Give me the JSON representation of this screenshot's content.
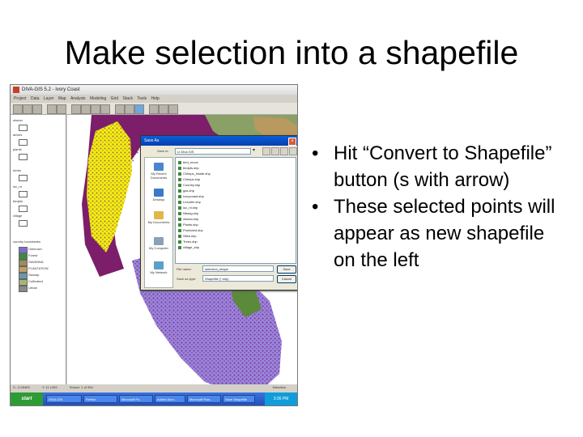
{
  "slide": {
    "title": "Make selection into a shapefile",
    "bullets": [
      "Hit “Convert to Shapefile” button (s with arrow)",
      "These selected points will appear as new shapefile on the left"
    ],
    "bullet_glyph": "•"
  },
  "screenshot": {
    "window_title": "DIVA-GIS 5.2 - Ivory Coast",
    "menu": [
      "Project",
      "Data",
      "Layer",
      "Map",
      "Analysis",
      "Modeling",
      "Grid",
      "Stack",
      "Tools",
      "Help"
    ],
    "layers": [
      "oiseau",
      "arbres",
      "plants",
      "herbs",
      "loc_nt",
      "birdpts",
      "village",
      "country boundaries"
    ],
    "legend": [
      "Unknown",
      "Forest",
      "SAVANNA",
      "PLANTATION",
      "Swamp",
      "Cultivated",
      "Urban"
    ],
    "status": {
      "x": "X: -5.26463",
      "y": "Y: 11.1453",
      "count": "Shown: 1 of 394",
      "mode": "Selection"
    },
    "taskbar": {
      "start_label": "start",
      "items": [
        "DIVA-GIS",
        "Firefox",
        "Microsoft Po...",
        "Adobe Acro...",
        "Microsoft Pow...",
        "Save Shapefile"
      ],
      "clock": "3:36 PM"
    },
    "colors": {
      "yellow": "#f2f010",
      "purple": "#7c1e6a",
      "lavender": "#9886e0",
      "olive": "#8aa066",
      "tan": "#b89960",
      "green": "#5b8a3a"
    }
  },
  "dialog": {
    "title": "Save As",
    "save_in_label": "Save in:",
    "save_in_value": "Lt Diva GIS",
    "places": [
      "My Recent Documents",
      "Desktop",
      "My Documents",
      "My Computer",
      "My Network"
    ],
    "files": [
      "bird_recos",
      "birdpts.shp",
      "Chimps_inside.shp",
      "Chimps.shp",
      "Country.shp",
      "gaz.shp",
      "Ivorycoast.shp",
      "Lmoutin.shp",
      "loc_nt.shp",
      "Nbasg.shp",
      "oiseau.shp",
      "Plants.shp",
      "Protected.shp",
      "Sites.shp",
      "Trees.shp",
      "village_shp"
    ],
    "filename_label": "File name:",
    "filename_value": "selection_shape",
    "filetype_label": "Save as type:",
    "filetype_value": "Shapefile (*.shp)",
    "save_button": "Save",
    "cancel_button": "Cancel"
  }
}
